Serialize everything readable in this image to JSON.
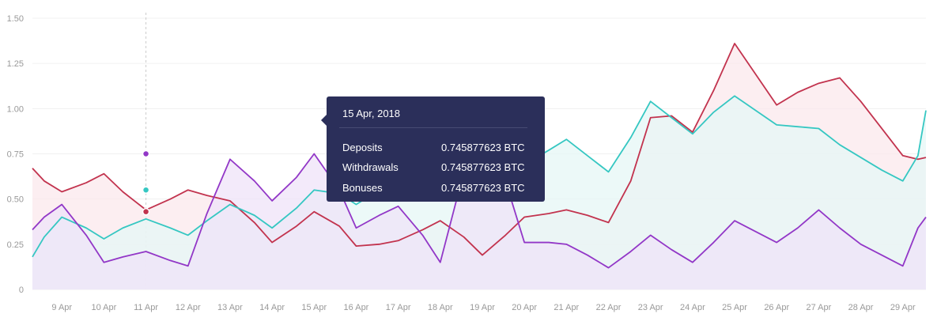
{
  "chart_data": {
    "type": "area",
    "categories": [
      "9 Apr",
      "10 Apr",
      "11 Apr",
      "12 Apr",
      "13 Apr",
      "14 Apr",
      "15 Apr",
      "16 Apr",
      "17 Apr",
      "18 Apr",
      "19 Apr",
      "20 Apr",
      "21 Apr",
      "22 Apr",
      "23 Apr",
      "24 Apr",
      "25 Apr",
      "26 Apr",
      "27 Apr",
      "28 Apr",
      "29 Apr"
    ],
    "x": [
      8.3,
      8.58,
      9.0,
      9.58,
      10.0,
      10.45,
      11.0,
      11.58,
      12.0,
      12.45,
      13.0,
      13.58,
      14.0,
      14.58,
      15.0,
      15.6,
      16.0,
      16.55,
      17.0,
      17.58,
      18.0,
      18.56,
      19.0,
      19.55,
      20.0,
      20.58,
      21.0,
      21.5,
      22.0,
      22.53,
      23.0,
      23.5,
      24.0,
      24.5,
      25.0,
      25.5,
      26.0,
      26.5,
      27.0,
      27.5,
      28.0,
      28.5,
      29.0,
      29.36,
      29.55
    ],
    "series": [
      {
        "name": "Deposits",
        "color": "#c2334e",
        "fill": "#fbe8ec",
        "values": [
          0.67,
          0.6,
          0.54,
          0.59,
          0.64,
          0.54,
          0.44,
          0.5,
          0.55,
          0.52,
          0.49,
          0.37,
          0.26,
          0.35,
          0.43,
          0.35,
          0.24,
          0.25,
          0.27,
          0.33,
          0.38,
          0.29,
          0.19,
          0.3,
          0.4,
          0.42,
          0.44,
          0.41,
          0.37,
          0.6,
          0.95,
          0.96,
          0.87,
          1.1,
          1.36,
          1.19,
          1.02,
          1.09,
          1.14,
          1.17,
          1.04,
          0.89,
          0.74,
          0.72,
          0.73
        ]
      },
      {
        "name": "Withdrawals",
        "color": "#35c7c2",
        "fill": "#e6f7f6",
        "values": [
          0.18,
          0.29,
          0.4,
          0.34,
          0.28,
          0.34,
          0.39,
          0.34,
          0.3,
          0.38,
          0.47,
          0.41,
          0.34,
          0.45,
          0.55,
          0.53,
          0.47,
          0.55,
          0.59,
          0.63,
          0.65,
          0.68,
          0.62,
          0.65,
          0.69,
          0.77,
          0.83,
          0.74,
          0.65,
          0.84,
          1.04,
          0.95,
          0.86,
          0.98,
          1.07,
          0.99,
          0.91,
          0.9,
          0.89,
          0.8,
          0.73,
          0.66,
          0.6,
          0.74,
          0.99
        ]
      },
      {
        "name": "Bonuses",
        "color": "#9237c7",
        "fill": "#efe3f8",
        "values": [
          0.33,
          0.4,
          0.47,
          0.3,
          0.15,
          0.18,
          0.21,
          0.16,
          0.13,
          0.42,
          0.72,
          0.6,
          0.49,
          0.62,
          0.75,
          0.55,
          0.34,
          0.41,
          0.46,
          0.3,
          0.15,
          0.65,
          1.02,
          0.6,
          0.26,
          0.26,
          0.25,
          0.19,
          0.12,
          0.21,
          0.3,
          0.22,
          0.15,
          0.26,
          0.38,
          0.32,
          0.26,
          0.34,
          0.44,
          0.34,
          0.25,
          0.19,
          0.13,
          0.34,
          0.4
        ]
      }
    ],
    "draw_order": [
      "Deposits",
      "Withdrawals",
      "Bonuses"
    ],
    "yticks": [
      "0",
      "0.25",
      "0.50",
      "0.75",
      "1.00",
      "1.25",
      "1.50"
    ],
    "ylim": [
      0,
      1.5
    ],
    "grid": true,
    "highlight_x": 11.0,
    "highlight_values": {
      "Deposits": 0.43,
      "Withdrawals": 0.55,
      "Bonuses": 0.75
    },
    "title": "",
    "xlabel": "",
    "ylabel": ""
  },
  "tooltip": {
    "date": "15 Apr, 2018",
    "rows": [
      {
        "label": "Deposits",
        "value": "0.745877623 BTC"
      },
      {
        "label": "Withdrawals",
        "value": "0.745877623 BTC"
      },
      {
        "label": "Bonuses",
        "value": "0.745877623 BTC"
      }
    ]
  },
  "colors": {
    "grid": "#f0f0f0",
    "axis_text": "#999999",
    "crosshair": "#cccccc"
  }
}
